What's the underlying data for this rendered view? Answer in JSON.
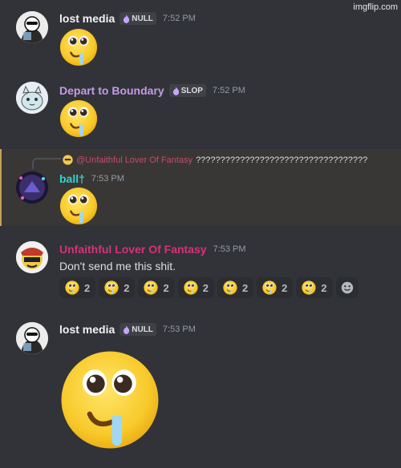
{
  "watermark": "imgflip.com",
  "messages": [
    {
      "author": "lost media",
      "tag": "NULL",
      "time": "7:52 PM"
    },
    {
      "author": "Depart to Boundary",
      "tag": "SLOP",
      "time": "7:52 PM"
    },
    {
      "author": "ball†",
      "time": "7:53 PM",
      "reply": {
        "mention": "@Unfaithful Lover Of Fantasy",
        "text": "???????????????????????????????????"
      }
    },
    {
      "author": "Unfaithful Lover Of Fantasy",
      "time": "7:53 PM",
      "text": "Don't send me this shit."
    },
    {
      "author": "lost media",
      "tag": "NULL",
      "time": "7:53 PM"
    }
  ],
  "reactions": [
    {
      "emoji": "drooling-face",
      "count": "2"
    },
    {
      "emoji": "drooling-face",
      "count": "2"
    },
    {
      "emoji": "drooling-face",
      "count": "2"
    },
    {
      "emoji": "drooling-face",
      "count": "2"
    },
    {
      "emoji": "drooling-face",
      "count": "2"
    },
    {
      "emoji": "drooling-face",
      "count": "2"
    },
    {
      "emoji": "drooling-face",
      "count": "2"
    }
  ],
  "colors": {
    "background": "#313338",
    "lost_media": "#f2f3f5",
    "depart": "#c49be6",
    "ball": "#2ed5d0",
    "unfaithful": "#d9307a",
    "highlight_bar": "#c5a157"
  }
}
